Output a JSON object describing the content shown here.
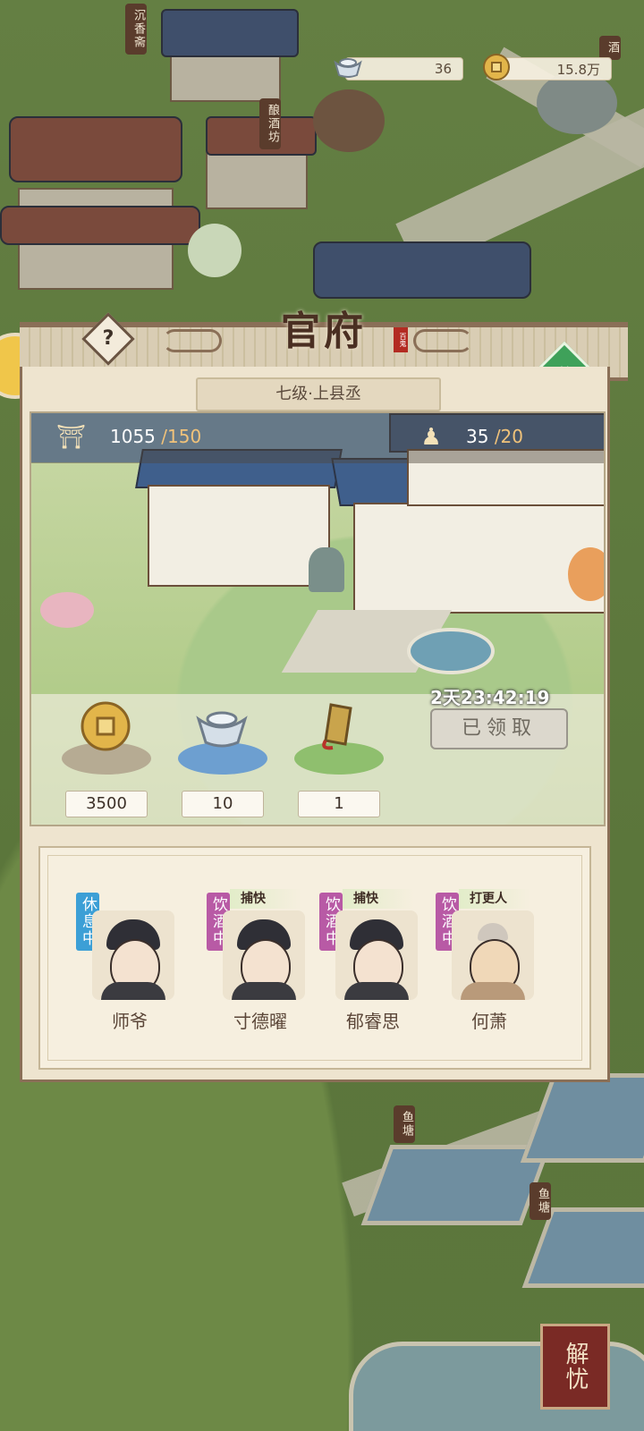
{
  "top_bar": {
    "silver": {
      "icon": "silver-ingot-icon",
      "value": "36"
    },
    "copper": {
      "icon": "copper-coin-icon",
      "value": "15.8万"
    }
  },
  "map_signs": {
    "chenxiangzhai": "沉香斋",
    "niangjiufang": "酿酒坊",
    "yutang_1": "鱼塘",
    "yutang_2": "鱼塘",
    "jiu": "酒"
  },
  "panel": {
    "title": "官府",
    "seal": "百鬼",
    "rank": "七级·上县丞",
    "help_icon": "question-icon",
    "upgrade_icon": "hammer-icon",
    "stats": {
      "prestige": {
        "icon": "pavilion-icon",
        "current": "1055",
        "max": "/150"
      },
      "staff": {
        "icon": "person-icon",
        "current": "35",
        "max": "/20"
      }
    },
    "rewards": [
      {
        "icon": "copper-coin-icon",
        "count": "3500"
      },
      {
        "icon": "silver-ingot-icon",
        "count": "10"
      },
      {
        "icon": "token-icon",
        "count": "1"
      }
    ],
    "timer": "2天23:42:19",
    "claim_label": "已领取",
    "staff_members": [
      {
        "name": "师爷",
        "status": "休息中",
        "status_type": "rest",
        "job": ""
      },
      {
        "name": "寸德曜",
        "status": "饮酒中",
        "status_type": "drink",
        "job": "捕快"
      },
      {
        "name": "郁睿思",
        "status": "饮酒中",
        "status_type": "drink",
        "job": "捕快"
      },
      {
        "name": "何萧",
        "status": "饮酒中",
        "status_type": "drink",
        "job": "打更人"
      }
    ]
  },
  "jieyou": "解忧",
  "colors": {
    "rest": "#3c9fd6",
    "drink": "#b85aa5",
    "accent_green": "#3fa15a"
  }
}
